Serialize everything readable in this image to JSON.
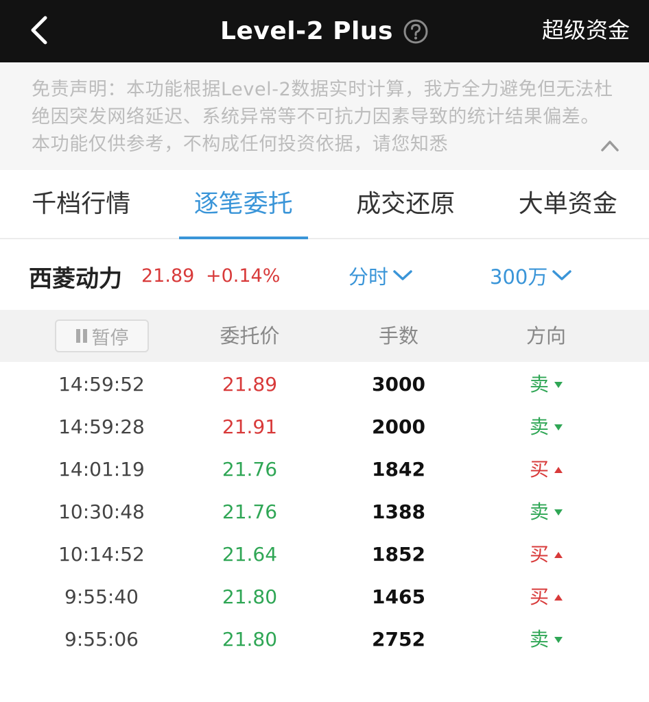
{
  "header": {
    "title": "Level-2 Plus",
    "right_link": "超级资金"
  },
  "disclaimer": {
    "text": "免责声明：本功能根据Level-2数据实时计算，我方全力避免但无法杜绝因突发网络延迟、系统异常等不可抗力因素导致的统计结果偏差。本功能仅供参考，不构成任何投资依据，请您知悉"
  },
  "tabs": [
    {
      "label": "千档行情",
      "active": false
    },
    {
      "label": "逐笔委托",
      "active": true
    },
    {
      "label": "成交还原",
      "active": false
    },
    {
      "label": "大单资金",
      "active": false
    }
  ],
  "stock": {
    "name": "西菱动力",
    "price": "21.89",
    "change": "+0.14%"
  },
  "filters": {
    "period": "分时",
    "amount": "300万"
  },
  "table": {
    "pause_label": "暂停",
    "columns": [
      "委托价",
      "手数",
      "方向"
    ],
    "rows": [
      {
        "time": "14:59:52",
        "price": "21.89",
        "qty": "3000",
        "dir": "卖",
        "price_color": "up",
        "dir_type": "sell"
      },
      {
        "time": "14:59:28",
        "price": "21.91",
        "qty": "2000",
        "dir": "卖",
        "price_color": "up",
        "dir_type": "sell"
      },
      {
        "time": "14:01:19",
        "price": "21.76",
        "qty": "1842",
        "dir": "买",
        "price_color": "down",
        "dir_type": "buy"
      },
      {
        "time": "10:30:48",
        "price": "21.76",
        "qty": "1388",
        "dir": "卖",
        "price_color": "down",
        "dir_type": "sell"
      },
      {
        "time": "10:14:52",
        "price": "21.64",
        "qty": "1852",
        "dir": "买",
        "price_color": "down",
        "dir_type": "buy"
      },
      {
        "time": "9:55:40",
        "price": "21.80",
        "qty": "1465",
        "dir": "买",
        "price_color": "down",
        "dir_type": "buy"
      },
      {
        "time": "9:55:06",
        "price": "21.80",
        "qty": "2752",
        "dir": "卖",
        "price_color": "down",
        "dir_type": "sell"
      }
    ]
  },
  "colors": {
    "accent": "#3a95d8",
    "up": "#d83a3a",
    "down": "#2fa655",
    "topbar": "#121212"
  },
  "icons": {
    "back": "chevron-left-icon",
    "help": "question-circle-icon",
    "collapse": "chevron-up-icon",
    "dropdown": "chevron-down-icon",
    "pause": "pause-icon"
  }
}
